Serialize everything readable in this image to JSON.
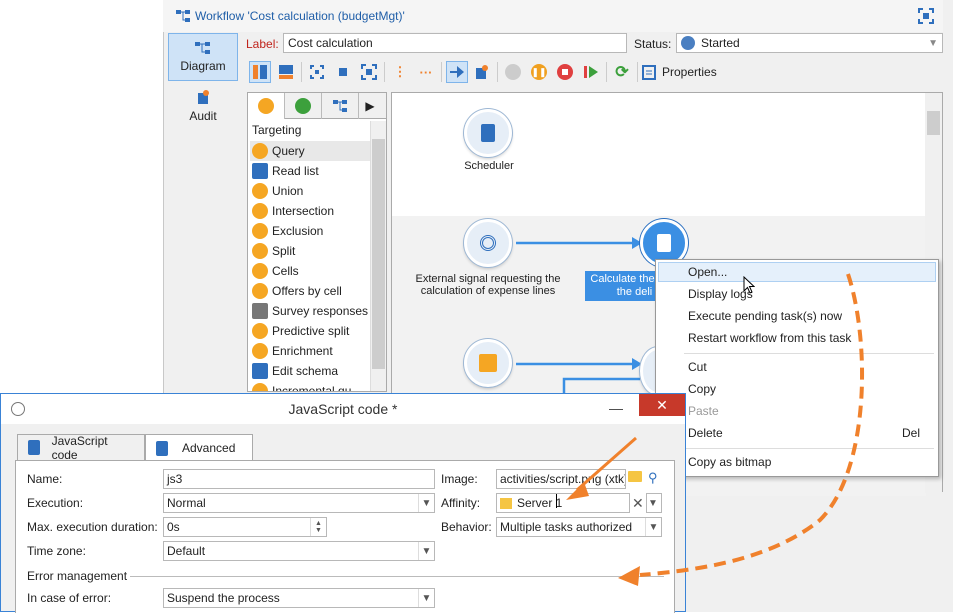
{
  "workflow": {
    "title": "Workflow 'Cost calculation (budgetMgt)'",
    "label_caption": "Label:",
    "label_value": "Cost calculation",
    "status_caption": "Status:",
    "status_value": "Started",
    "properties_label": "Properties",
    "tabs": {
      "diagram": "Diagram",
      "audit": "Audit"
    }
  },
  "palette": {
    "section": "Targeting",
    "items": [
      "Query",
      "Read list",
      "Union",
      "Intersection",
      "Exclusion",
      "Split",
      "Cells",
      "Offers by cell",
      "Survey responses",
      "Predictive split",
      "Enrichment",
      "Edit schema",
      "Incremental qu..."
    ]
  },
  "canvas": {
    "nodes": {
      "scheduler": "Scheduler",
      "external_signal": "External signal requesting the calculation of expense lines",
      "calculate": "Calculate the",
      "calculate2": "the deli"
    }
  },
  "context_menu": {
    "items": [
      "Open...",
      "Display logs",
      "Execute pending task(s) now",
      "Restart workflow from this task",
      "Cut",
      "Copy",
      "Paste",
      "Delete",
      "Copy as bitmap"
    ],
    "delete_shortcut": "Del"
  },
  "dialog": {
    "title": "JavaScript code *",
    "tabs": [
      "JavaScript code",
      "Advanced"
    ],
    "name_label": "Name:",
    "name_value": "js3",
    "execution_label": "Execution:",
    "execution_value": "Normal",
    "max_label": "Max. execution duration:",
    "max_value": "0s",
    "timezone_label": "Time zone:",
    "timezone_value": "Default",
    "image_label": "Image:",
    "image_value": "activities/script.png (xtk)",
    "affinity_label": "Affinity:",
    "affinity_value": "Server 1",
    "behavior_label": "Behavior:",
    "behavior_value": "Multiple tasks authorized",
    "error_section": "Error management",
    "error_label": "In case of error:",
    "error_value": "Suspend the process"
  },
  "colors": {
    "accent": "#3a83d6",
    "orange": "#f0812c",
    "selected": "#3b8fe3"
  }
}
